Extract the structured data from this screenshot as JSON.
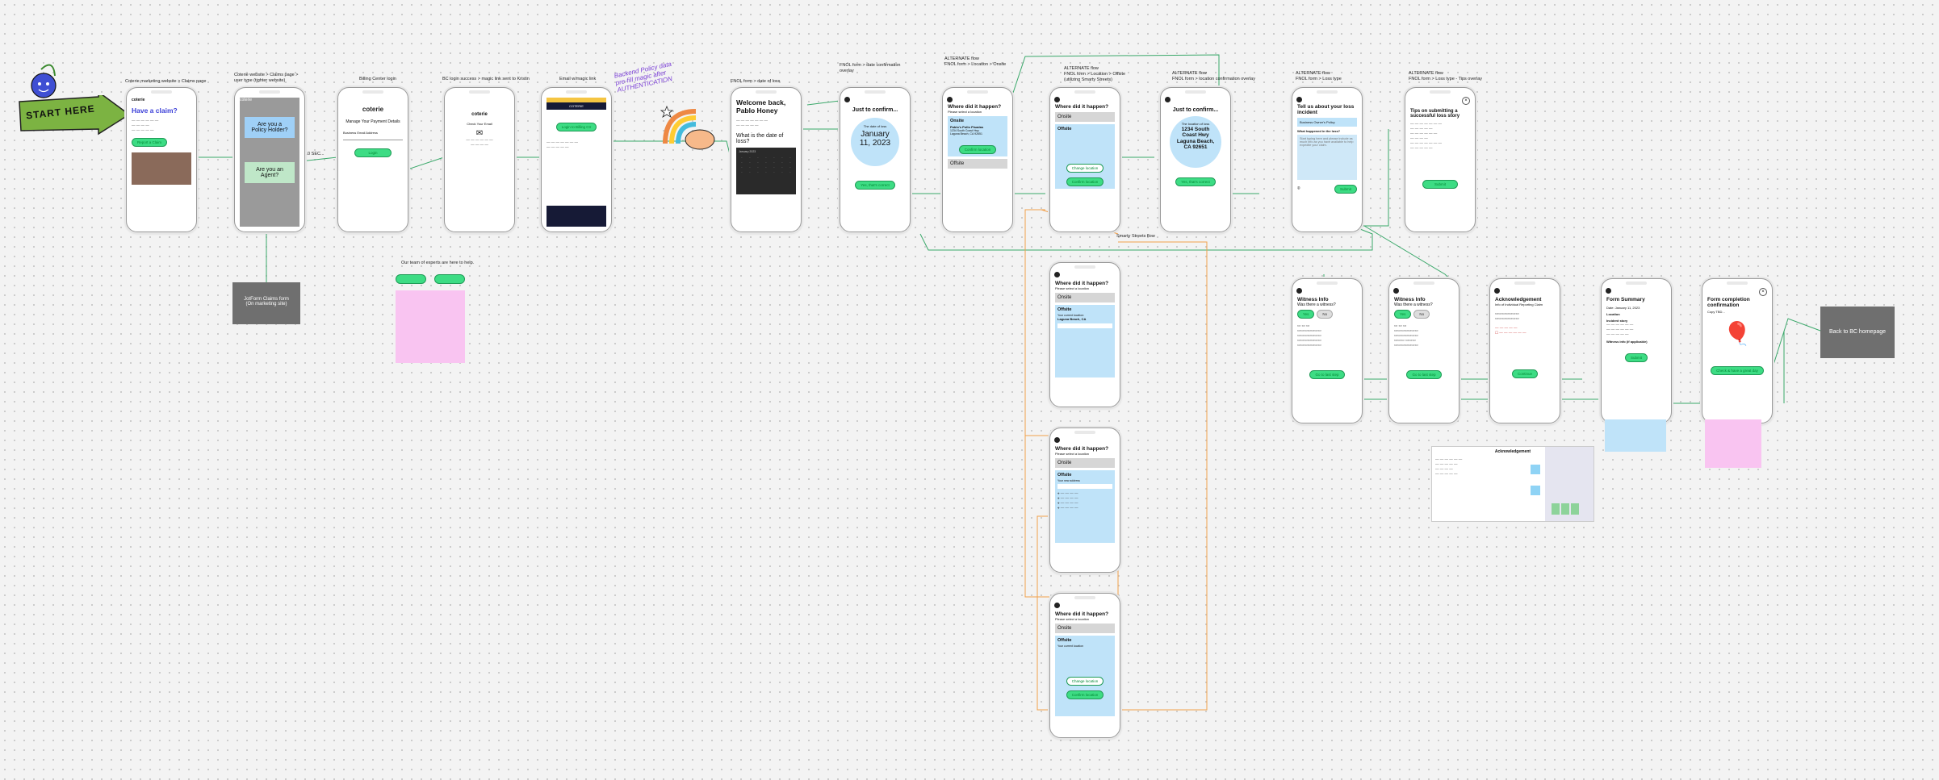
{
  "start": {
    "text": "START HERE"
  },
  "labels": {
    "s1": "Coterie marketing website > Claims page",
    "s2": "Coterie website > Claims page >\nuser type (tighter website)",
    "s3": "Billing Center login",
    "s4": "BC login success > magic link sent to Kristin",
    "s5": "Email w/magic link",
    "s6": "FNOL form > date of loss",
    "s7": "FNOL form > date confirmation\noverlay",
    "s8": "ALTERNATE flow\nFNOL form > Location > Onsite",
    "s9": "ALTERNATE flow\nFNOL form > Location > Offsite\n(utilizing Smarty Streets)",
    "s10": "ALTERNATE flow\nFNOL form > location confirmation overlay",
    "s11": "ALTERNATE flow\nFNOL form > Loss type",
    "s12": "ALTERNATE flow\nFNOL form > Loss type - Tips overlay",
    "smarty": "Smarty Streets flow",
    "handwrite": "Backend Policy data\npre-fill magic after\nAUTHENTICATION",
    "ten_sec": "10 SEC..."
  },
  "screens": {
    "s1": {
      "logo": "coterie",
      "title": "Have a claim?",
      "button": "Report a Claim"
    },
    "s2": {
      "logo": "coterie",
      "q1": "Are you a Policy Holder?",
      "q2": "Are you an Agent?"
    },
    "s3": {
      "logo": "coterie",
      "title": "Manage Your Payment Details",
      "field": "Business Email Address",
      "button": "Login"
    },
    "s4": {
      "logo": "coterie",
      "title": "Check Your Email"
    },
    "s5": {
      "brand": "COTERIE",
      "button": "Login to Billing Ctr"
    },
    "s6": {
      "title": "Welcome back,\nPablo Honey",
      "question": "What is the date of loss?",
      "month": "January 2023"
    },
    "s7": {
      "title": "Just to confirm...",
      "caption": "The date of loss",
      "date": "January\n11, 2023",
      "button": "Yes, that's correct"
    },
    "s8": {
      "title": "Where did it happen?",
      "sub": "Please select a location",
      "onsite": "Onsite",
      "biz1": "Pablo's Pollo Pisadas",
      "addr1": "1234 South Coast Hwy\nLaguna Beach, CA 92651",
      "button": "Confirm location",
      "offsite": "Offsite"
    },
    "s9": {
      "title": "Where did it happen?",
      "onsite": "Onsite",
      "offsite": "Offsite",
      "change": "Change location",
      "button": "Confirm location"
    },
    "s10": {
      "title": "Just to confirm...",
      "caption": "The location of loss",
      "addr": "1234 South\nCoast Hwy\nLaguna Beach,\nCA 92651",
      "button": "Yes, that's correct"
    },
    "s11": {
      "title": "Tell us about your loss incident",
      "option": "Business Owner's Policy",
      "q": "What happened in the loss?",
      "placeholder": "Start typing here and please include as much info as you have available to help expedite your claim.",
      "button": "Submit"
    },
    "s12": {
      "title": "Tips on submitting a successful loss story",
      "button": "Submit"
    },
    "s13": {
      "title": "Where did it happen?",
      "sub": "Please select a location",
      "onsite": "Onsite",
      "offsite": "Offsite",
      "current": "Your current location:",
      "addr": "Laguna Beach, CA"
    },
    "s14": {
      "title": "Where did it happen?",
      "sub": "Please select a location",
      "onsite": "Onsite",
      "offsite": "Offsite",
      "search": "Your new address"
    },
    "s15": {
      "title": "Where did it happen?",
      "sub": "Please select a location",
      "onsite": "Onsite",
      "offsite": "Offsite",
      "current": "Your current location",
      "change": "Change location",
      "button": "Confirm location"
    },
    "s16": {
      "title": "Witness Info",
      "q": "Was there a witness?",
      "yes": "Yes",
      "no": "No",
      "button": "Go to last step"
    },
    "s17": {
      "title": "Witness Info",
      "q": "Was there a witness?",
      "yes": "Yes",
      "no": "No",
      "button": "Go to last step"
    },
    "s18": {
      "title": "Acknowledgement",
      "sub": "Info of Individual Reporting Claim",
      "button": "Continue"
    },
    "s19": {
      "title": "Form Summary",
      "date": "Date: January 11, 2023",
      "loc": "Location",
      "incident": "Incident story",
      "witness": "Witness info (if applicable)",
      "button": "Submit"
    },
    "s20": {
      "title": "Form completion confirmation",
      "sub": "Copy TBD...",
      "button": "Check & have a great day"
    }
  },
  "side_boxes": {
    "jotform": "JotForm Claims form\n(On marketing site)",
    "back_bc": "Back to BC homepage",
    "experts": "Our team of experts are here to help.",
    "ack_doc": "Acknowledgement"
  },
  "colors": {
    "green": "#3ddc84",
    "blue": "#bfe3f9",
    "pink": "#f9c4f1",
    "grey": "#6f6f6f"
  }
}
